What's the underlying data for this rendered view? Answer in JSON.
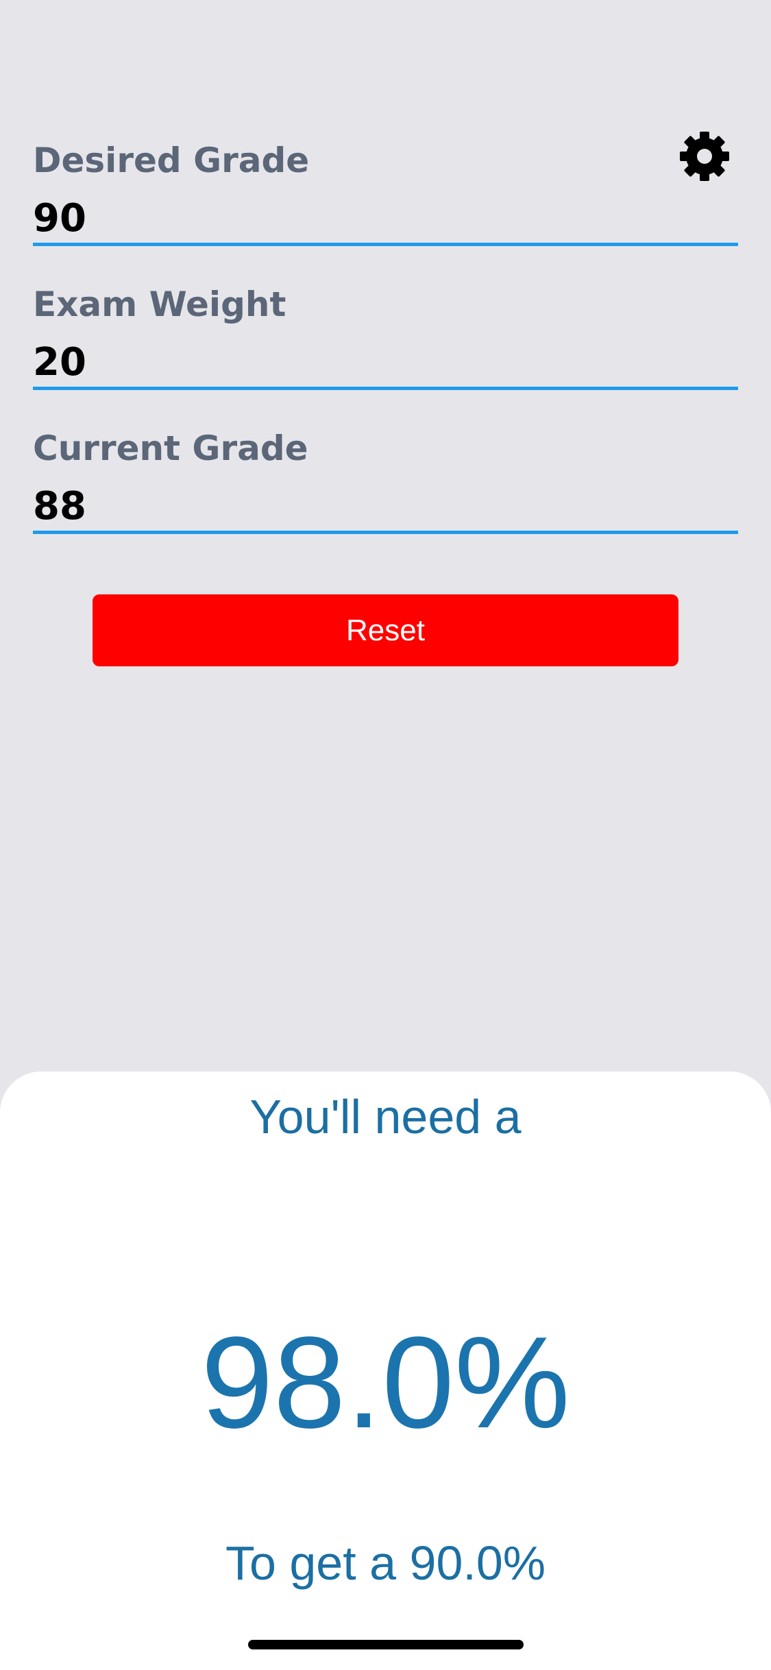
{
  "form": {
    "desired_grade": {
      "label": "Desired Grade",
      "value": "90"
    },
    "exam_weight": {
      "label": "Exam Weight",
      "value": "20"
    },
    "current_grade": {
      "label": "Current Grade",
      "value": "88"
    }
  },
  "icons": {
    "settings": "gear-icon"
  },
  "reset_button": {
    "label": "Reset",
    "color": "#ff0000"
  },
  "result": {
    "intro": "You'll need a",
    "required_percent": "98.0%",
    "target_text": "To get a 90.0%"
  },
  "colors": {
    "accent": "#1f9be9",
    "result_text": "#1b74ad",
    "background": "#e6e6ea"
  }
}
